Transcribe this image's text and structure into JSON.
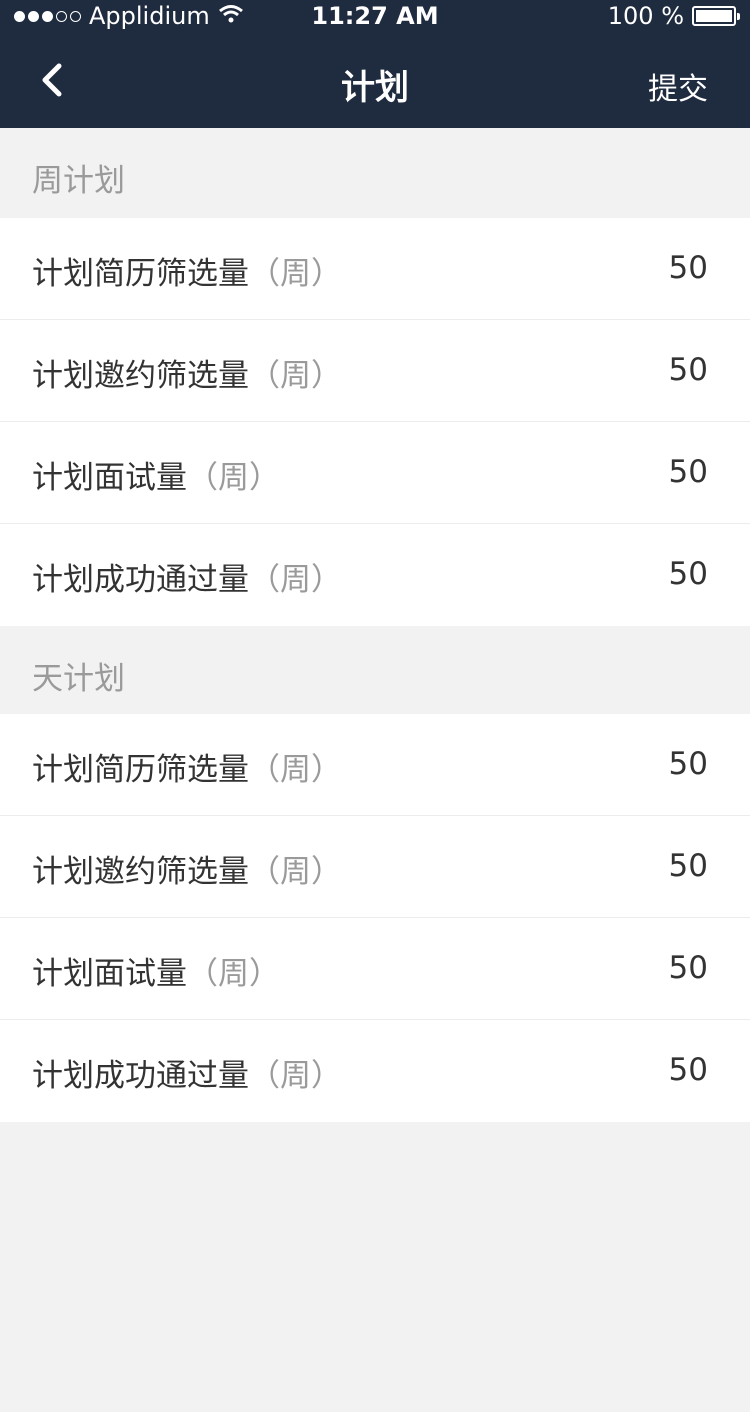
{
  "status_bar": {
    "carrier": "Applidium",
    "time": "11:27 AM",
    "battery": "100 %"
  },
  "nav": {
    "title": "计划",
    "submit_label": "提交"
  },
  "sections": [
    {
      "header": "周计划",
      "rows": [
        {
          "label": "计划简历筛选量",
          "suffix": "（周）",
          "value": "50"
        },
        {
          "label": "计划邀约筛选量",
          "suffix": "（周）",
          "value": "50"
        },
        {
          "label": "计划面试量",
          "suffix": "（周）",
          "value": "50"
        },
        {
          "label": "计划成功通过量",
          "suffix": "（周）",
          "value": "50"
        }
      ]
    },
    {
      "header": "天计划",
      "rows": [
        {
          "label": "计划简历筛选量",
          "suffix": "（周）",
          "value": "50"
        },
        {
          "label": "计划邀约筛选量",
          "suffix": "（周）",
          "value": "50"
        },
        {
          "label": "计划面试量",
          "suffix": "（周）",
          "value": "50"
        },
        {
          "label": "计划成功通过量",
          "suffix": "（周）",
          "value": "50"
        }
      ]
    }
  ]
}
